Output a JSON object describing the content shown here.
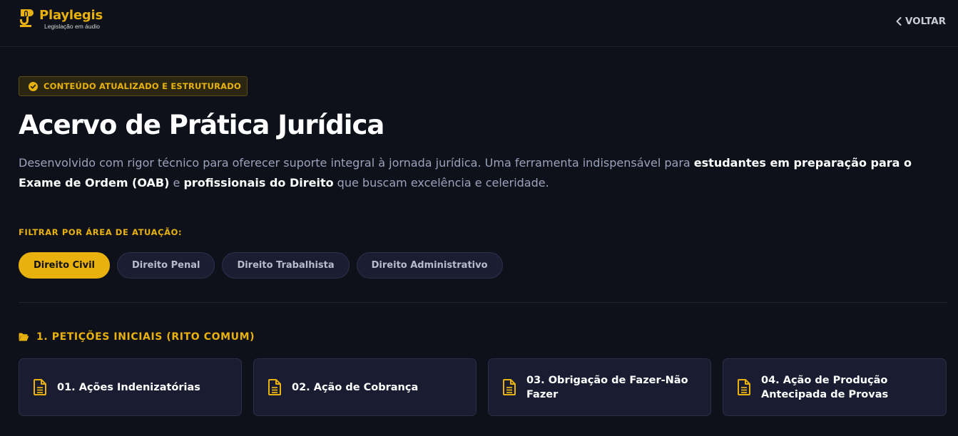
{
  "header": {
    "logo_name": "Playlegis",
    "logo_tagline": "Legislação em áudio",
    "back_label": "VOLTAR"
  },
  "hero": {
    "badge": "CONTEÚDO ATUALIZADO E ESTRUTURADO",
    "title": "Acervo de Prática Jurídica",
    "description": {
      "part1": "Desenvolvido com rigor técnico para oferecer suporte integral à jornada jurídica. Uma ferramenta indispensável para ",
      "bold1": "estudantes em preparação para o Exame de Ordem (OAB)",
      "part2": " e ",
      "bold2": "profissionais do Direito",
      "part3": " que buscam excelência e celeridade."
    }
  },
  "filter": {
    "label": "FILTRAR POR ÁREA DE ATUAÇÃO:",
    "options": [
      "Direito Civil",
      "Direito Penal",
      "Direito Trabalhista",
      "Direito Administrativo"
    ],
    "selected": "Direito Civil"
  },
  "section": {
    "title": "1. PETIÇÕES INICIAIS (RITO COMUM)",
    "icon": "folder-open-icon",
    "cards": [
      {
        "label": "01. Ações Indenizatórias",
        "icon": "document-icon"
      },
      {
        "label": "02. Ação de Cobrança",
        "icon": "document-icon"
      },
      {
        "label": "03. Obrigação de Fazer-Não Fazer",
        "icon": "document-icon"
      },
      {
        "label": "04. Ação de Produção Antecipada de Provas",
        "icon": "document-icon"
      }
    ]
  },
  "colors": {
    "background": "#0f111a",
    "accent": "#e8b10e",
    "card": "#1a1d31",
    "muted_text": "#9aa3bb"
  }
}
